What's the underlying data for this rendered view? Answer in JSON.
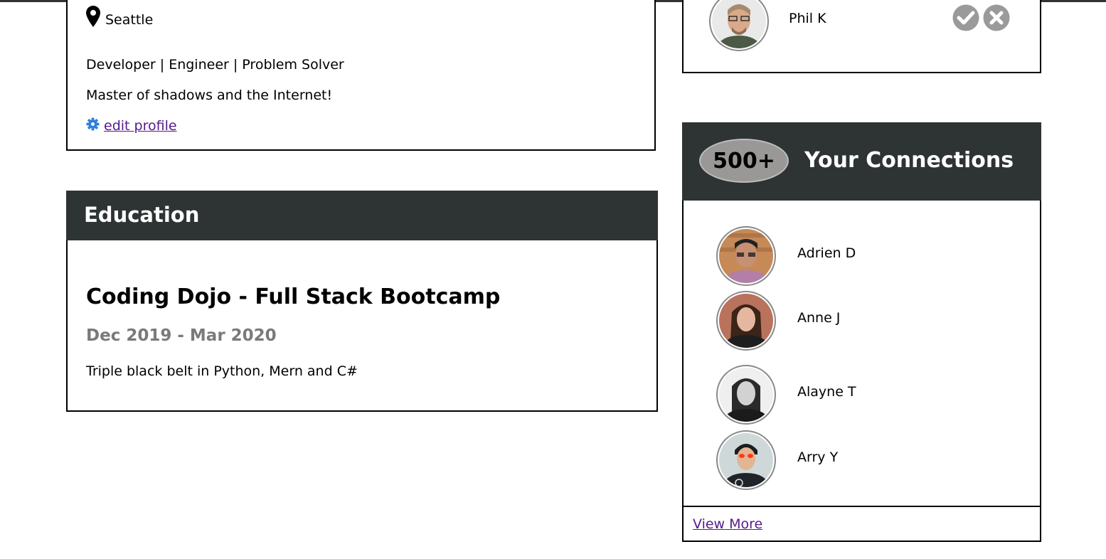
{
  "profile": {
    "location": "Seattle",
    "headline": "Developer | Engineer | Problem Solver",
    "bio": "Master of shadows and the Internet!",
    "edit_link": "edit profile"
  },
  "education": {
    "section_title": "Education",
    "school": "Coding Dojo - Full Stack Bootcamp",
    "dates": "Dec 2019 - Mar 2020",
    "description": "Triple black belt in Python, Mern and C#"
  },
  "pending_request": {
    "name": "Phil K"
  },
  "connections": {
    "count": "500+",
    "title": "Your Connections",
    "people": [
      {
        "name": "Adrien D"
      },
      {
        "name": "Anne J"
      },
      {
        "name": "Alayne T"
      },
      {
        "name": "Arry Y"
      }
    ],
    "view_more": "View More"
  },
  "colors": {
    "header_bg": "#2e3333",
    "link": "#551a8b",
    "gear_icon": "#2f7fe0",
    "action_icon": "#9a9a9a",
    "badge_bg": "#9a9797"
  },
  "icons": [
    "map-pin-icon",
    "gear-icon",
    "checkmark-icon",
    "close-icon"
  ]
}
